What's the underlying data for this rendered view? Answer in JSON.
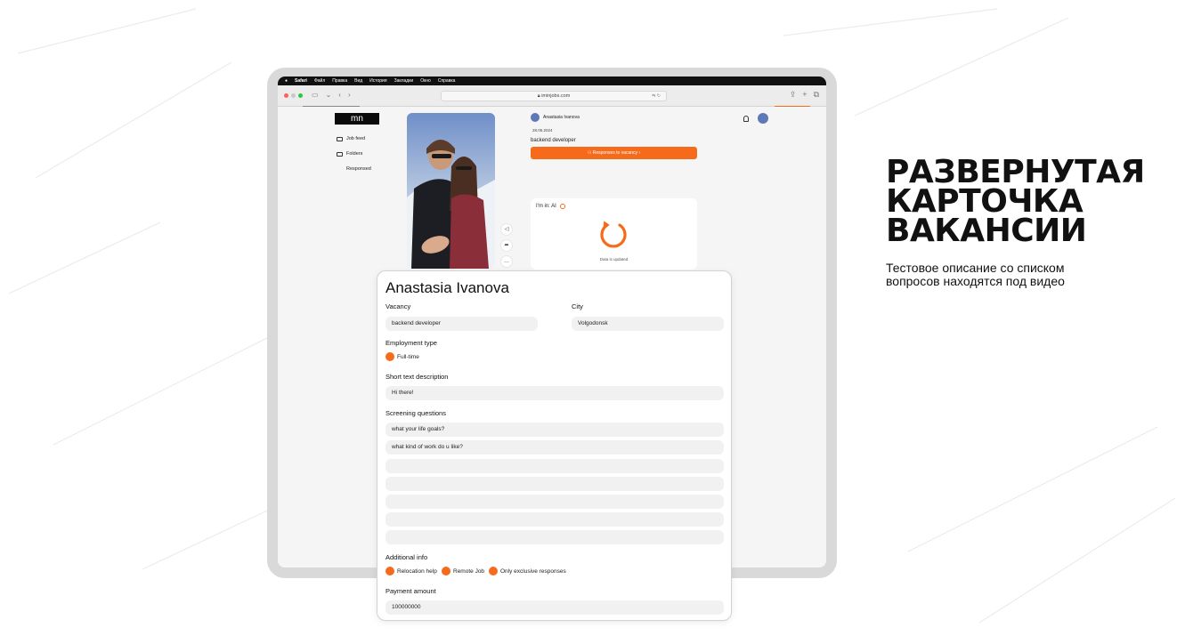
{
  "menubar": {
    "apple": "",
    "app": "Safari",
    "items": [
      "Файл",
      "Правка",
      "Вид",
      "История",
      "Закладки",
      "Окно",
      "Справка"
    ]
  },
  "browser": {
    "url": "iminjobs.com",
    "translate": "⇆ ↻"
  },
  "app": {
    "logo": "mn",
    "sidebar": [
      {
        "label": "Job feed",
        "icon": "stack-icon"
      },
      {
        "label": "Folders",
        "icon": "folder-icon"
      },
      {
        "label": "Responsed",
        "icon": ""
      }
    ],
    "profile": {
      "name": "Anastasia Ivanova",
      "date": "28.05.2024",
      "vacancy": "backend developer",
      "responses_button": "Responses to vacancy"
    },
    "ai_card": {
      "title": "I'm in: AI",
      "status": "Data is updated"
    }
  },
  "card": {
    "name": "Anastasia Ivanova",
    "vacancy_label": "Vacancy",
    "vacancy_value": "backend developer",
    "city_label": "City",
    "city_value": "Volgodonsk",
    "employment_label": "Employment type",
    "employment_value": "Full-time",
    "short_label": "Short text description",
    "short_value": "Hi there!",
    "screening_label": "Screening questions",
    "questions": [
      "what your life goals?",
      "what kind of work do u like?",
      "",
      "",
      "",
      "",
      ""
    ],
    "additional_label": "Additional info",
    "additional": [
      "Relocation help",
      "Remote Job",
      "Only exclusive responses"
    ],
    "payment_label": "Payment amount",
    "payment_value": "100000000"
  },
  "headline": {
    "line1": "РАЗВЕРНУТАЯ",
    "line2": "КАРТОЧКА",
    "line3": "ВАКАНСИИ",
    "sub": "Тестовое описание со списком вопросов находятся под видео"
  },
  "colors": {
    "accent": "#f56b1b"
  }
}
